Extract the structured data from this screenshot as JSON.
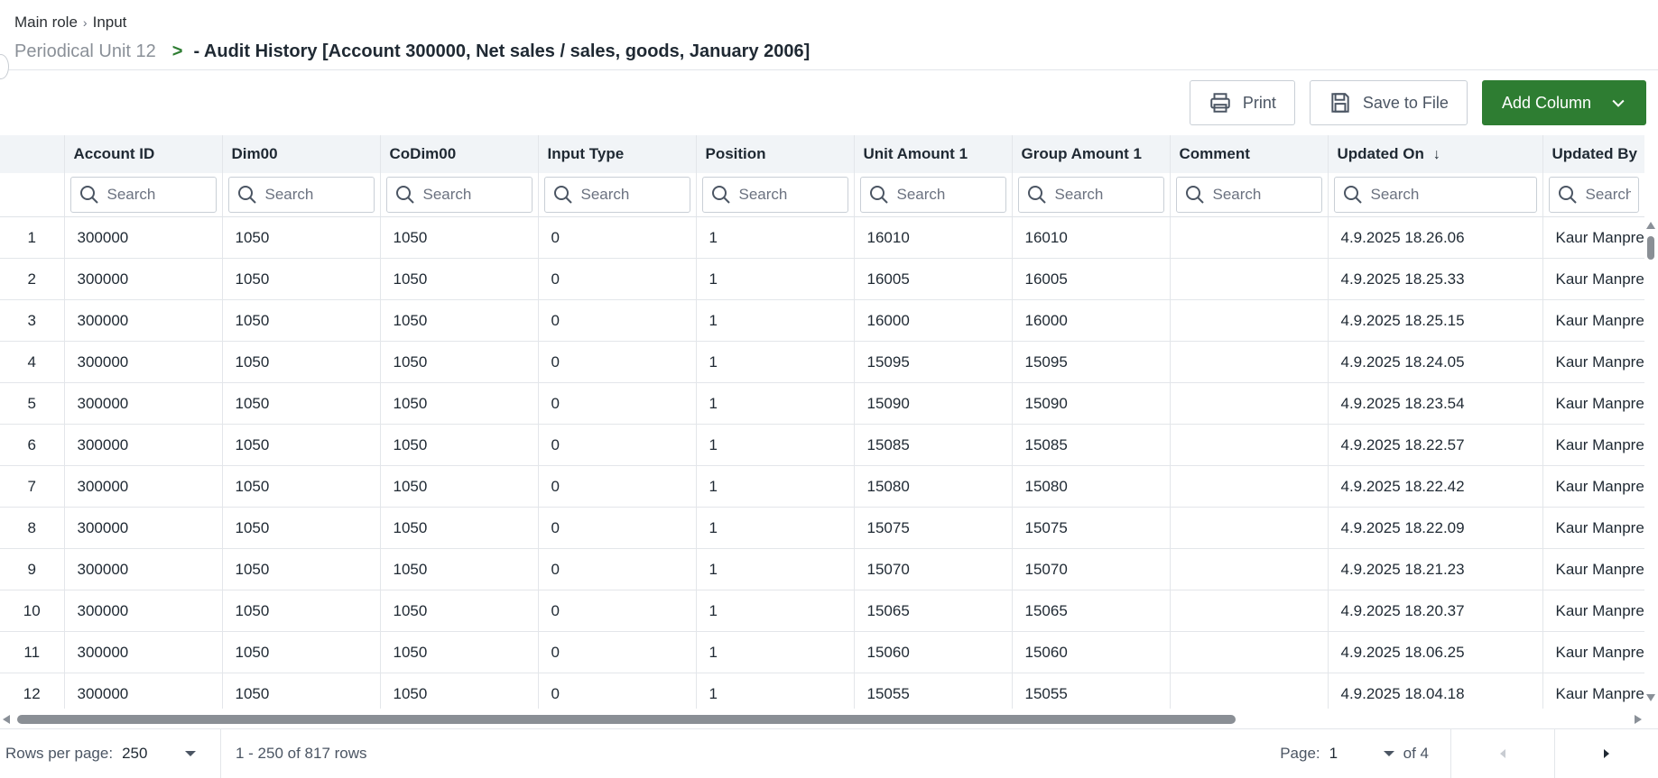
{
  "breadcrumb": {
    "items": [
      "Main role",
      "Input"
    ]
  },
  "title": {
    "unit": "Periodical Unit 12",
    "arrow": ">",
    "main": "- Audit History [Account 300000, Net sales / sales, goods, January 2006]"
  },
  "toolbar": {
    "print_label": "Print",
    "save_label": "Save to File",
    "add_column_label": "Add Column"
  },
  "grid": {
    "columns": [
      {
        "label": "Account ID",
        "key": "account_id"
      },
      {
        "label": "Dim00",
        "key": "dim00"
      },
      {
        "label": "CoDim00",
        "key": "codim00"
      },
      {
        "label": "Input Type",
        "key": "input_type"
      },
      {
        "label": "Position",
        "key": "position"
      },
      {
        "label": "Unit Amount 1",
        "key": "unit_amount"
      },
      {
        "label": "Group Amount 1",
        "key": "group_amount"
      },
      {
        "label": "Comment",
        "key": "comment"
      },
      {
        "label": "Updated On",
        "key": "updated_on",
        "sort": "↓"
      },
      {
        "label": "Updated By",
        "key": "updated_by"
      }
    ],
    "search_placeholder": "Search",
    "rows": [
      [
        "1",
        "300000",
        "1050",
        "1050",
        "0",
        "1",
        "16010",
        "16010",
        "",
        "4.9.2025 18.26.06",
        "Kaur Manpre"
      ],
      [
        "2",
        "300000",
        "1050",
        "1050",
        "0",
        "1",
        "16005",
        "16005",
        "",
        "4.9.2025 18.25.33",
        "Kaur Manpre"
      ],
      [
        "3",
        "300000",
        "1050",
        "1050",
        "0",
        "1",
        "16000",
        "16000",
        "",
        "4.9.2025 18.25.15",
        "Kaur Manpre"
      ],
      [
        "4",
        "300000",
        "1050",
        "1050",
        "0",
        "1",
        "15095",
        "15095",
        "",
        "4.9.2025 18.24.05",
        "Kaur Manpre"
      ],
      [
        "5",
        "300000",
        "1050",
        "1050",
        "0",
        "1",
        "15090",
        "15090",
        "",
        "4.9.2025 18.23.54",
        "Kaur Manpre"
      ],
      [
        "6",
        "300000",
        "1050",
        "1050",
        "0",
        "1",
        "15085",
        "15085",
        "",
        "4.9.2025 18.22.57",
        "Kaur Manpre"
      ],
      [
        "7",
        "300000",
        "1050",
        "1050",
        "0",
        "1",
        "15080",
        "15080",
        "",
        "4.9.2025 18.22.42",
        "Kaur Manpre"
      ],
      [
        "8",
        "300000",
        "1050",
        "1050",
        "0",
        "1",
        "15075",
        "15075",
        "",
        "4.9.2025 18.22.09",
        "Kaur Manpre"
      ],
      [
        "9",
        "300000",
        "1050",
        "1050",
        "0",
        "1",
        "15070",
        "15070",
        "",
        "4.9.2025 18.21.23",
        "Kaur Manpre"
      ],
      [
        "10",
        "300000",
        "1050",
        "1050",
        "0",
        "1",
        "15065",
        "15065",
        "",
        "4.9.2025 18.20.37",
        "Kaur Manpre"
      ],
      [
        "11",
        "300000",
        "1050",
        "1050",
        "0",
        "1",
        "15060",
        "15060",
        "",
        "4.9.2025 18.06.25",
        "Kaur Manpre"
      ],
      [
        "12",
        "300000",
        "1050",
        "1050",
        "0",
        "1",
        "15055",
        "15055",
        "",
        "4.9.2025 18.04.18",
        "Kaur Manpre"
      ]
    ]
  },
  "footer": {
    "rows_per_page_label": "Rows per page:",
    "rows_per_page_value": "250",
    "range_text": "1 - 250 of 817 rows",
    "page_label": "Page:",
    "page_value": "1",
    "page_of": "of 4"
  },
  "colors": {
    "primary": "#2e7d32",
    "header_bg": "#f1f4f7",
    "border": "#e3e6ea"
  },
  "icons": {
    "print": "printer-icon",
    "save": "floppy-disk-icon",
    "add_column": "chevron-down-icon",
    "search": "search-icon"
  }
}
